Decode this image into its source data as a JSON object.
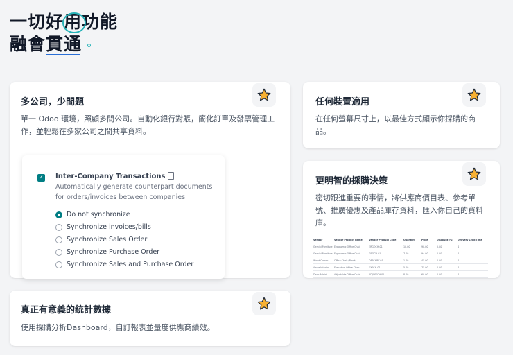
{
  "hero": {
    "line1": "一切好用功能",
    "line2": "融會貫通"
  },
  "colors": {
    "accent_teal": "#27b3b8",
    "accent_blue": "#2a6fd6",
    "odoo_teal": "#017e84",
    "star": "#f8b133"
  },
  "cards": {
    "multi_company": {
      "title": "多公司，少問題",
      "desc_line1": "單一 Odoo 環境，照顧多間公司。自動化銀行對賬，簡化訂單及發票管理工",
      "desc_line2": "作，並輕鬆在多家公司之間共享資料。",
      "icon": "star-icon"
    },
    "any_device": {
      "title": "任何裝置適用",
      "desc_line1": "在任何螢幕尺寸上，以最佳方式顯示你採購的商",
      "desc_line2": "品。",
      "icon": "star-icon"
    },
    "smarter_decisions": {
      "title": "更明智的採購決策",
      "desc_line1": "密切跟進重要的事情，將供應商價目表、參考單",
      "desc_line2": "號、推廣優惠及產品庫存資料，匯入你自己的資料",
      "desc_line3": "庫。",
      "icon": "star-icon"
    },
    "statistics": {
      "title": "真正有意義的統計數據",
      "desc": "使用採購分析Dashboard，自訂報表並量度供應商績效。",
      "icon": "star-icon"
    }
  },
  "inter_company": {
    "checked": true,
    "title": "Inter-Company Transactions",
    "subtitle": "Automatically generate counterpart documents for orders/invoices between companies",
    "options": [
      {
        "label": "Do not synchronize",
        "selected": true
      },
      {
        "label": "Synchronize invoices/bills",
        "selected": false
      },
      {
        "label": "Synchronize Sales Order",
        "selected": false
      },
      {
        "label": "Synchronize Purchase Order",
        "selected": false
      },
      {
        "label": "Synchronize Sales and Purchase Order",
        "selected": false
      }
    ]
  },
  "vendor_table": {
    "headers": [
      "Vendor",
      "Vendor Product Name",
      "Vendor Product Code",
      "Quantity",
      "Price",
      "Discount (%)",
      "Delivery Lead Time"
    ],
    "rows": [
      [
        "Gemini Furniture",
        "Ergonomic Office Chair",
        "ERGOCH-01",
        "10.00",
        "90.00",
        "5.00",
        "4"
      ],
      [
        "Gemini Furniture",
        "Ergonomic Office Chair",
        "GEOCH-01",
        "7.00",
        "94.00",
        "0.00",
        "4"
      ],
      [
        "Wood Corner",
        "Office Chair (Black)",
        "OFFCHBK-01",
        "1.00",
        "45.00",
        "0.00",
        "4"
      ],
      [
        "Azure Interior",
        "Executive Office Chair",
        "EXECH-01",
        "5.00",
        "75.00",
        "0.00",
        "4"
      ],
      [
        "Deco Addict",
        "Adjustable Office Chair",
        "ADJOFFCH-01",
        "8.00",
        "60.00",
        "0.00",
        "4"
      ]
    ]
  }
}
